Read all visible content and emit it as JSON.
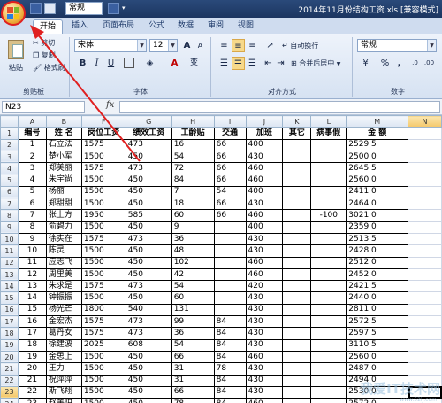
{
  "window": {
    "title": "2014年11月份结构工资.xls [兼容模式]",
    "font_top": "常规"
  },
  "tabs": [
    "开始",
    "插入",
    "页面布局",
    "公式",
    "数据",
    "审阅",
    "视图"
  ],
  "ribbon": {
    "clipboard": {
      "paste": "粘贴",
      "cut": "剪切",
      "copy": "复制",
      "format_painter": "格式刷",
      "label": "剪贴板"
    },
    "font": {
      "family": "宋体",
      "size": "12",
      "label": "字体",
      "bold": "B",
      "italic": "I",
      "underline": "U",
      "grow": "A",
      "shrink": "A",
      "color_a": "A",
      "wen": "变"
    },
    "alignment": {
      "wrap": "自动换行",
      "merge": "合并后居中",
      "label": "对齐方式"
    },
    "number": {
      "format": "常规",
      "percent": "%",
      "comma": ",",
      "label": "数字"
    }
  },
  "formula_bar": {
    "cell": "N23",
    "fx": "fx",
    "value": ""
  },
  "sheet": {
    "columns": [
      "A",
      "B",
      "F",
      "G",
      "H",
      "I",
      "J",
      "K",
      "L",
      "M",
      "N"
    ],
    "header": [
      "编号",
      "姓 名",
      "岗位工资",
      "绩效工资",
      "工龄贴",
      "交通",
      "加班",
      "其它",
      "病事假",
      "金 额",
      ""
    ],
    "rows": [
      [
        "1",
        "石立法",
        "1575",
        "473",
        "16",
        "66",
        "400",
        "",
        "",
        "2529.5",
        ""
      ],
      [
        "2",
        "楚小军",
        "1500",
        "450",
        "54",
        "66",
        "430",
        "",
        "",
        "2500.0",
        ""
      ],
      [
        "3",
        "郑美丽",
        "1575",
        "473",
        "72",
        "66",
        "460",
        "",
        "",
        "2645.5",
        ""
      ],
      [
        "4",
        "朱宇尚",
        "1500",
        "450",
        "84",
        "66",
        "460",
        "",
        "",
        "2560.0",
        ""
      ],
      [
        "5",
        "杨丽",
        "1500",
        "450",
        "7",
        "54",
        "400",
        "",
        "",
        "2411.0",
        ""
      ],
      [
        "6",
        "郑甜甜",
        "1500",
        "450",
        "18",
        "66",
        "430",
        "",
        "",
        "2464.0",
        ""
      ],
      [
        "7",
        "张上方",
        "1950",
        "585",
        "60",
        "66",
        "460",
        "",
        "-100",
        "3021.0",
        ""
      ],
      [
        "8",
        "俞碧力",
        "1500",
        "450",
        "9",
        "",
        "400",
        "",
        "",
        "2359.0",
        ""
      ],
      [
        "9",
        "徐实在",
        "1575",
        "473",
        "36",
        "",
        "430",
        "",
        "",
        "2513.5",
        ""
      ],
      [
        "10",
        "陈灵",
        "1500",
        "450",
        "48",
        "",
        "430",
        "",
        "",
        "2428.0",
        ""
      ],
      [
        "11",
        "应志飞",
        "1500",
        "450",
        "102",
        "",
        "460",
        "",
        "",
        "2512.0",
        ""
      ],
      [
        "12",
        "周里美",
        "1500",
        "450",
        "42",
        "",
        "460",
        "",
        "",
        "2452.0",
        ""
      ],
      [
        "13",
        "朱求是",
        "1575",
        "473",
        "54",
        "",
        "420",
        "",
        "",
        "2421.5",
        ""
      ],
      [
        "14",
        "钟振振",
        "1500",
        "450",
        "60",
        "",
        "430",
        "",
        "",
        "2440.0",
        ""
      ],
      [
        "15",
        "杨光芒",
        "1800",
        "540",
        "131",
        "",
        "430",
        "",
        "",
        "2811.0",
        ""
      ],
      [
        "16",
        "金宏杰",
        "1575",
        "473",
        "99",
        "84",
        "430",
        "",
        "",
        "2572.5",
        ""
      ],
      [
        "17",
        "葛丹女",
        "1575",
        "473",
        "36",
        "84",
        "430",
        "",
        "",
        "2597.5",
        ""
      ],
      [
        "18",
        "徐建波",
        "2025",
        "608",
        "54",
        "84",
        "430",
        "",
        "",
        "3110.5",
        ""
      ],
      [
        "19",
        "金思上",
        "1500",
        "450",
        "66",
        "84",
        "460",
        "",
        "",
        "2560.0",
        ""
      ],
      [
        "20",
        "王力",
        "1500",
        "450",
        "31",
        "78",
        "430",
        "",
        "",
        "2487.0",
        ""
      ],
      [
        "21",
        "祝萍萍",
        "1500",
        "450",
        "31",
        "84",
        "430",
        "",
        "",
        "2494.0",
        ""
      ],
      [
        "22",
        "斯飞翔",
        "1500",
        "450",
        "66",
        "84",
        "430",
        "",
        "",
        "2530.0",
        ""
      ],
      [
        "23",
        "赵美阳",
        "1500",
        "450",
        "78",
        "84",
        "460",
        "",
        "",
        "2572.0",
        ""
      ]
    ]
  },
  "watermark": {
    "main": "我爱IT技术网",
    "sub": "www.52ij.com"
  },
  "colors": {
    "accent": "#2a4a7a",
    "arrow": "#e02020",
    "header_active": "#f4c86a"
  }
}
